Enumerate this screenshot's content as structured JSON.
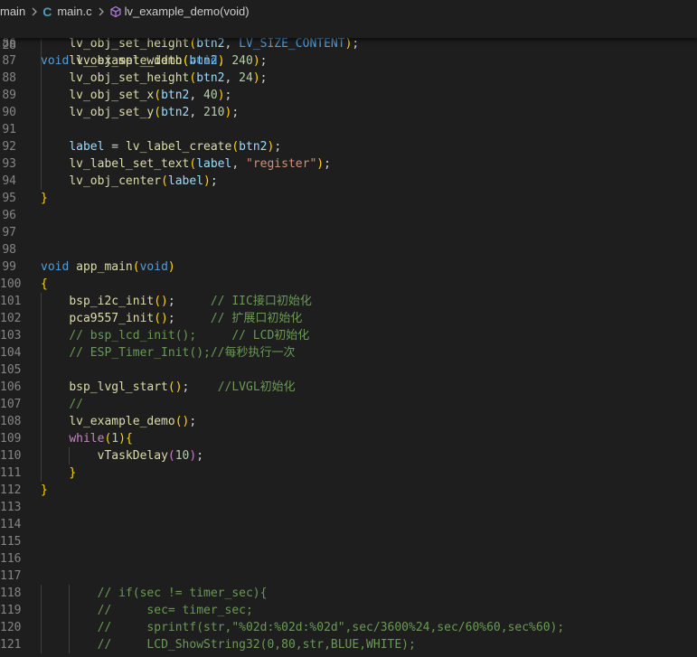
{
  "breadcrumb": {
    "folder": "main",
    "file": "main.c",
    "symbol": "lv_example_demo(void)"
  },
  "sticky_scroll": {
    "line_number": "28",
    "segments": [
      {
        "text": "void",
        "cls": "t-kw"
      },
      {
        "text": " ",
        "cls": ""
      },
      {
        "text": "lv_example_demo",
        "cls": "t-fn"
      },
      {
        "text": "(",
        "cls": "t-p1"
      },
      {
        "text": "void",
        "cls": "t-kw"
      },
      {
        "text": ")",
        "cls": "t-p1"
      }
    ]
  },
  "code_lines": [
    {
      "n": "86",
      "guides": 1,
      "segs": [
        [
          "    ",
          ""
        ],
        [
          "lv_obj_set_height",
          "t-fn"
        ],
        [
          "(",
          "t-p1"
        ],
        [
          "btn2",
          "t-var"
        ],
        [
          ", ",
          ""
        ],
        [
          "LV_SIZE_CONTENT",
          "t-mac"
        ],
        [
          ")",
          "t-p1"
        ],
        [
          ";",
          ""
        ]
      ]
    },
    {
      "n": "87",
      "guides": 1,
      "segs": [
        [
          "    ",
          ""
        ],
        [
          "lv_obj_set_width",
          "t-fn"
        ],
        [
          "(",
          "t-p1"
        ],
        [
          "btn2",
          "t-var"
        ],
        [
          ", ",
          ""
        ],
        [
          "240",
          "t-num"
        ],
        [
          ")",
          "t-p1"
        ],
        [
          ";",
          ""
        ]
      ]
    },
    {
      "n": "88",
      "guides": 1,
      "segs": [
        [
          "    ",
          ""
        ],
        [
          "lv_obj_set_height",
          "t-fn"
        ],
        [
          "(",
          "t-p1"
        ],
        [
          "btn2",
          "t-var"
        ],
        [
          ", ",
          ""
        ],
        [
          "24",
          "t-num"
        ],
        [
          ")",
          "t-p1"
        ],
        [
          ";",
          ""
        ]
      ]
    },
    {
      "n": "89",
      "guides": 1,
      "segs": [
        [
          "    ",
          ""
        ],
        [
          "lv_obj_set_x",
          "t-fn"
        ],
        [
          "(",
          "t-p1"
        ],
        [
          "btn2",
          "t-var"
        ],
        [
          ", ",
          ""
        ],
        [
          "40",
          "t-num"
        ],
        [
          ")",
          "t-p1"
        ],
        [
          ";",
          ""
        ]
      ]
    },
    {
      "n": "90",
      "guides": 1,
      "segs": [
        [
          "    ",
          ""
        ],
        [
          "lv_obj_set_y",
          "t-fn"
        ],
        [
          "(",
          "t-p1"
        ],
        [
          "btn2",
          "t-var"
        ],
        [
          ", ",
          ""
        ],
        [
          "210",
          "t-num"
        ],
        [
          ")",
          "t-p1"
        ],
        [
          ";",
          ""
        ]
      ]
    },
    {
      "n": "91",
      "guides": 1,
      "segs": []
    },
    {
      "n": "92",
      "guides": 1,
      "segs": [
        [
          "    ",
          ""
        ],
        [
          "label",
          "t-var"
        ],
        [
          " = ",
          ""
        ],
        [
          "lv_label_create",
          "t-fn"
        ],
        [
          "(",
          "t-p1"
        ],
        [
          "btn2",
          "t-var"
        ],
        [
          ")",
          "t-p1"
        ],
        [
          ";",
          ""
        ]
      ]
    },
    {
      "n": "93",
      "guides": 1,
      "segs": [
        [
          "    ",
          ""
        ],
        [
          "lv_label_set_text",
          "t-fn"
        ],
        [
          "(",
          "t-p1"
        ],
        [
          "label",
          "t-var"
        ],
        [
          ", ",
          ""
        ],
        [
          "\"register\"",
          "t-str"
        ],
        [
          ")",
          "t-p1"
        ],
        [
          ";",
          ""
        ]
      ]
    },
    {
      "n": "94",
      "guides": 1,
      "segs": [
        [
          "    ",
          ""
        ],
        [
          "lv_obj_center",
          "t-fn"
        ],
        [
          "(",
          "t-p1"
        ],
        [
          "label",
          "t-var"
        ],
        [
          ")",
          "t-p1"
        ],
        [
          ";",
          ""
        ]
      ]
    },
    {
      "n": "95",
      "guides": 0,
      "segs": [
        [
          "}",
          "t-p1"
        ]
      ]
    },
    {
      "n": "96",
      "guides": 0,
      "segs": []
    },
    {
      "n": "97",
      "guides": 0,
      "segs": []
    },
    {
      "n": "98",
      "guides": 0,
      "segs": []
    },
    {
      "n": "99",
      "guides": 0,
      "segs": [
        [
          "void",
          "t-kw"
        ],
        [
          " ",
          ""
        ],
        [
          "app_main",
          "t-fn"
        ],
        [
          "(",
          "t-p1"
        ],
        [
          "void",
          "t-kw"
        ],
        [
          ")",
          "t-p1"
        ]
      ]
    },
    {
      "n": "100",
      "guides": 0,
      "segs": [
        [
          "{",
          "t-p1"
        ]
      ]
    },
    {
      "n": "101",
      "guides": 1,
      "segs": [
        [
          "    ",
          ""
        ],
        [
          "bsp_i2c_init",
          "t-fn"
        ],
        [
          "()",
          "t-p1"
        ],
        [
          ";     ",
          ""
        ],
        [
          "// IIC接口初始化",
          "t-cm"
        ]
      ]
    },
    {
      "n": "102",
      "guides": 1,
      "segs": [
        [
          "    ",
          ""
        ],
        [
          "pca9557_init",
          "t-fn"
        ],
        [
          "()",
          "t-p1"
        ],
        [
          ";     ",
          ""
        ],
        [
          "// 扩展口初始化",
          "t-cm"
        ]
      ]
    },
    {
      "n": "103",
      "guides": 1,
      "segs": [
        [
          "    ",
          ""
        ],
        [
          "// bsp_lcd_init();     // LCD初始化",
          "t-cm"
        ]
      ]
    },
    {
      "n": "104",
      "guides": 1,
      "segs": [
        [
          "    ",
          ""
        ],
        [
          "// ESP_Timer_Init();//每秒执行一次",
          "t-cm"
        ]
      ]
    },
    {
      "n": "105",
      "guides": 1,
      "segs": []
    },
    {
      "n": "106",
      "guides": 1,
      "segs": [
        [
          "    ",
          ""
        ],
        [
          "bsp_lvgl_start",
          "t-fn"
        ],
        [
          "()",
          "t-p1"
        ],
        [
          ";    ",
          ""
        ],
        [
          "//LVGL初始化",
          "t-cm"
        ]
      ]
    },
    {
      "n": "107",
      "guides": 1,
      "segs": [
        [
          "    ",
          ""
        ],
        [
          "//",
          "t-cm"
        ]
      ]
    },
    {
      "n": "108",
      "guides": 1,
      "segs": [
        [
          "    ",
          ""
        ],
        [
          "lv_example_demo",
          "t-fn"
        ],
        [
          "()",
          "t-p1"
        ],
        [
          ";",
          ""
        ]
      ]
    },
    {
      "n": "109",
      "guides": 1,
      "segs": [
        [
          "    ",
          ""
        ],
        [
          "while",
          "t-ctrl"
        ],
        [
          "(",
          "t-p1"
        ],
        [
          "1",
          "t-num"
        ],
        [
          ")",
          "t-p1"
        ],
        [
          "{",
          "t-p1"
        ]
      ]
    },
    {
      "n": "110",
      "guides": 2,
      "segs": [
        [
          "        ",
          ""
        ],
        [
          "vTaskDelay",
          "t-fn"
        ],
        [
          "(",
          "t-p2"
        ],
        [
          "10",
          "t-num"
        ],
        [
          ")",
          "t-p2"
        ],
        [
          ";",
          ""
        ]
      ]
    },
    {
      "n": "111",
      "guides": 1,
      "segs": [
        [
          "    ",
          ""
        ],
        [
          "}",
          "t-p1"
        ]
      ]
    },
    {
      "n": "112",
      "guides": 0,
      "segs": [
        [
          "}",
          "t-p1"
        ]
      ]
    },
    {
      "n": "113",
      "guides": 0,
      "segs": []
    },
    {
      "n": "114",
      "guides": 0,
      "segs": []
    },
    {
      "n": "115",
      "guides": 0,
      "segs": []
    },
    {
      "n": "116",
      "guides": 0,
      "segs": []
    },
    {
      "n": "117",
      "guides": 0,
      "segs": []
    },
    {
      "n": "118",
      "guides": 2,
      "segs": [
        [
          "        ",
          ""
        ],
        [
          "// if(sec != timer_sec){",
          "t-cm"
        ]
      ]
    },
    {
      "n": "119",
      "guides": 2,
      "segs": [
        [
          "        ",
          ""
        ],
        [
          "//     sec= timer_sec;",
          "t-cm"
        ]
      ]
    },
    {
      "n": "120",
      "guides": 2,
      "segs": [
        [
          "        ",
          ""
        ],
        [
          "//     sprintf(str,\"%02d:%02d:%02d\",sec/3600%24,sec/60%60,sec%60);",
          "t-cm"
        ]
      ]
    },
    {
      "n": "121",
      "guides": 2,
      "segs": [
        [
          "        ",
          ""
        ],
        [
          "//     LCD_ShowString32(0,80,str,BLUE,WHITE);",
          "t-cm"
        ]
      ]
    }
  ]
}
